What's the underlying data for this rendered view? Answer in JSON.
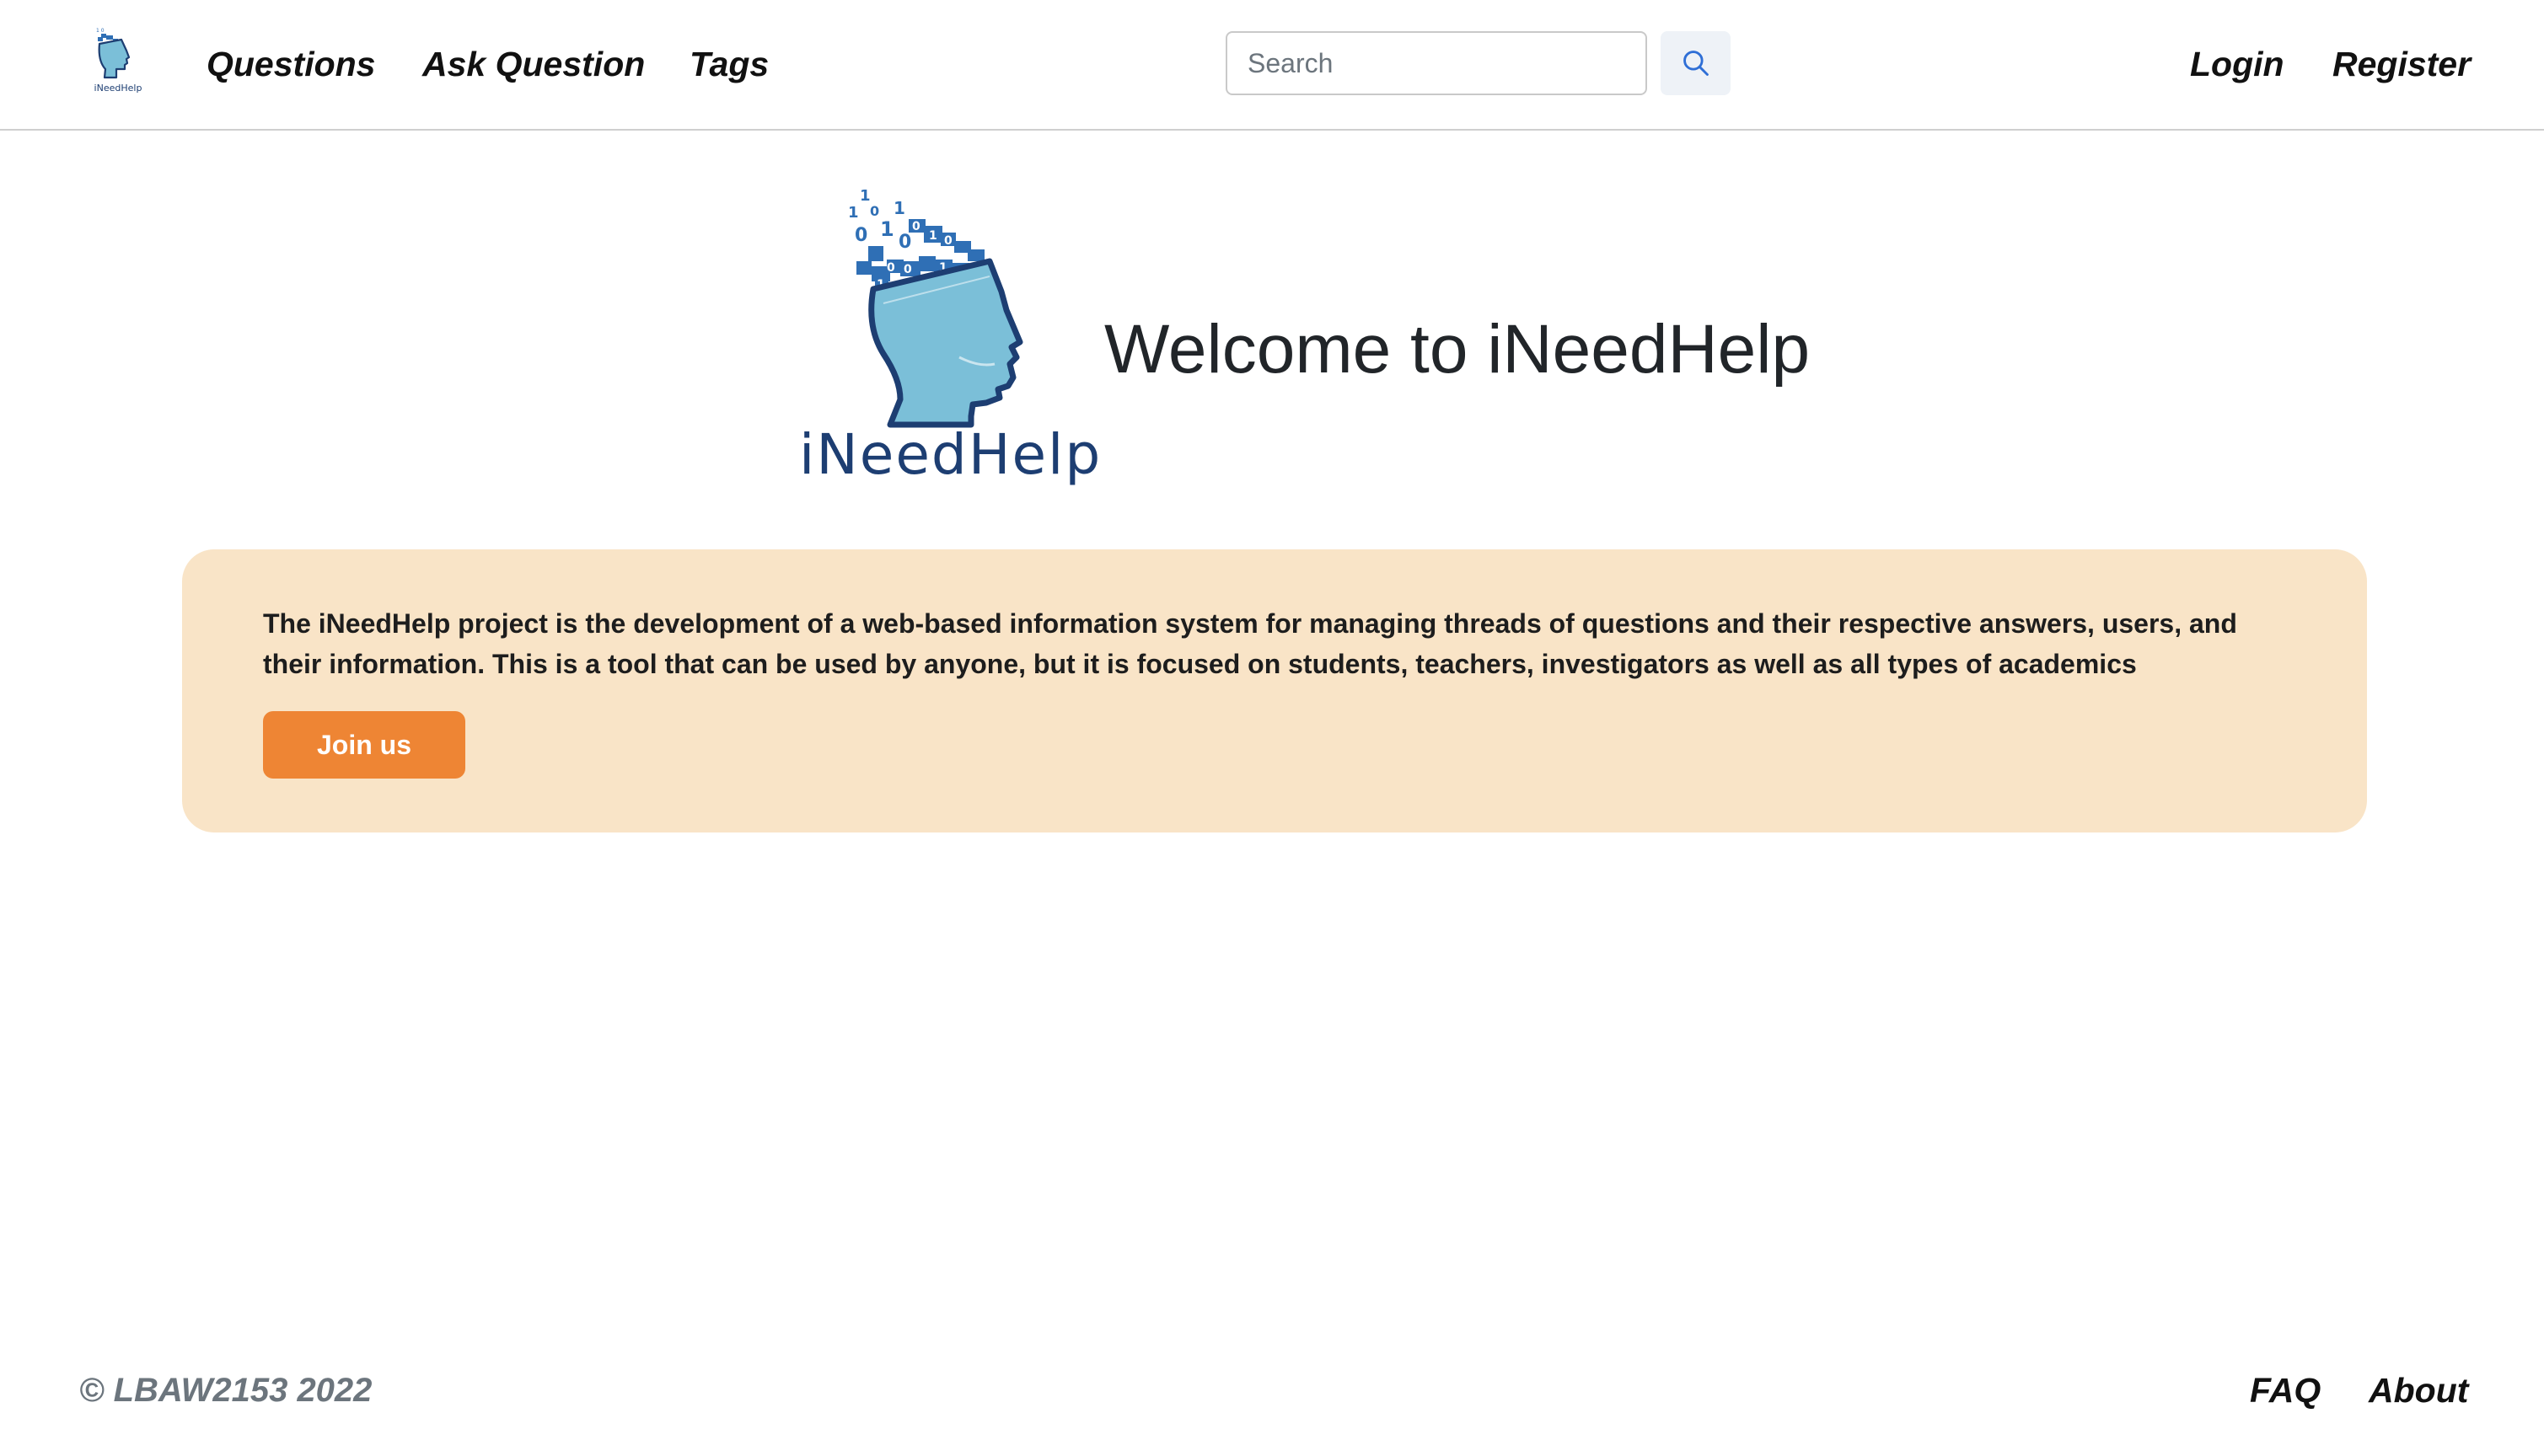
{
  "navbar": {
    "logo_text": "iNeedHelp",
    "links": {
      "questions": "Questions",
      "ask_question": "Ask Question",
      "tags": "Tags"
    },
    "search": {
      "placeholder": "Search",
      "value": "",
      "icon": "search-icon"
    },
    "auth": {
      "login": "Login",
      "register": "Register"
    }
  },
  "hero": {
    "logo_text": "iNeedHelp",
    "title": "Welcome to iNeedHelp"
  },
  "info_card": {
    "text": "The iNeedHelp project is the development of a web-based information system for managing threads of questions and their respective answers, users, and their information. This is a tool that can be used by anyone, but it is focused on students, teachers, investigators as well as all types of academics",
    "button_label": "Join us"
  },
  "footer": {
    "copyright": "© LBAW2153 2022",
    "links": {
      "faq": "FAQ",
      "about": "About"
    }
  },
  "colors": {
    "accent_button": "#ee8534",
    "card_background": "#f9e4c7",
    "brand_dark_blue": "#1d3e72",
    "brand_light_blue": "#7bbfd8",
    "search_button_bg": "#eef2f7"
  }
}
